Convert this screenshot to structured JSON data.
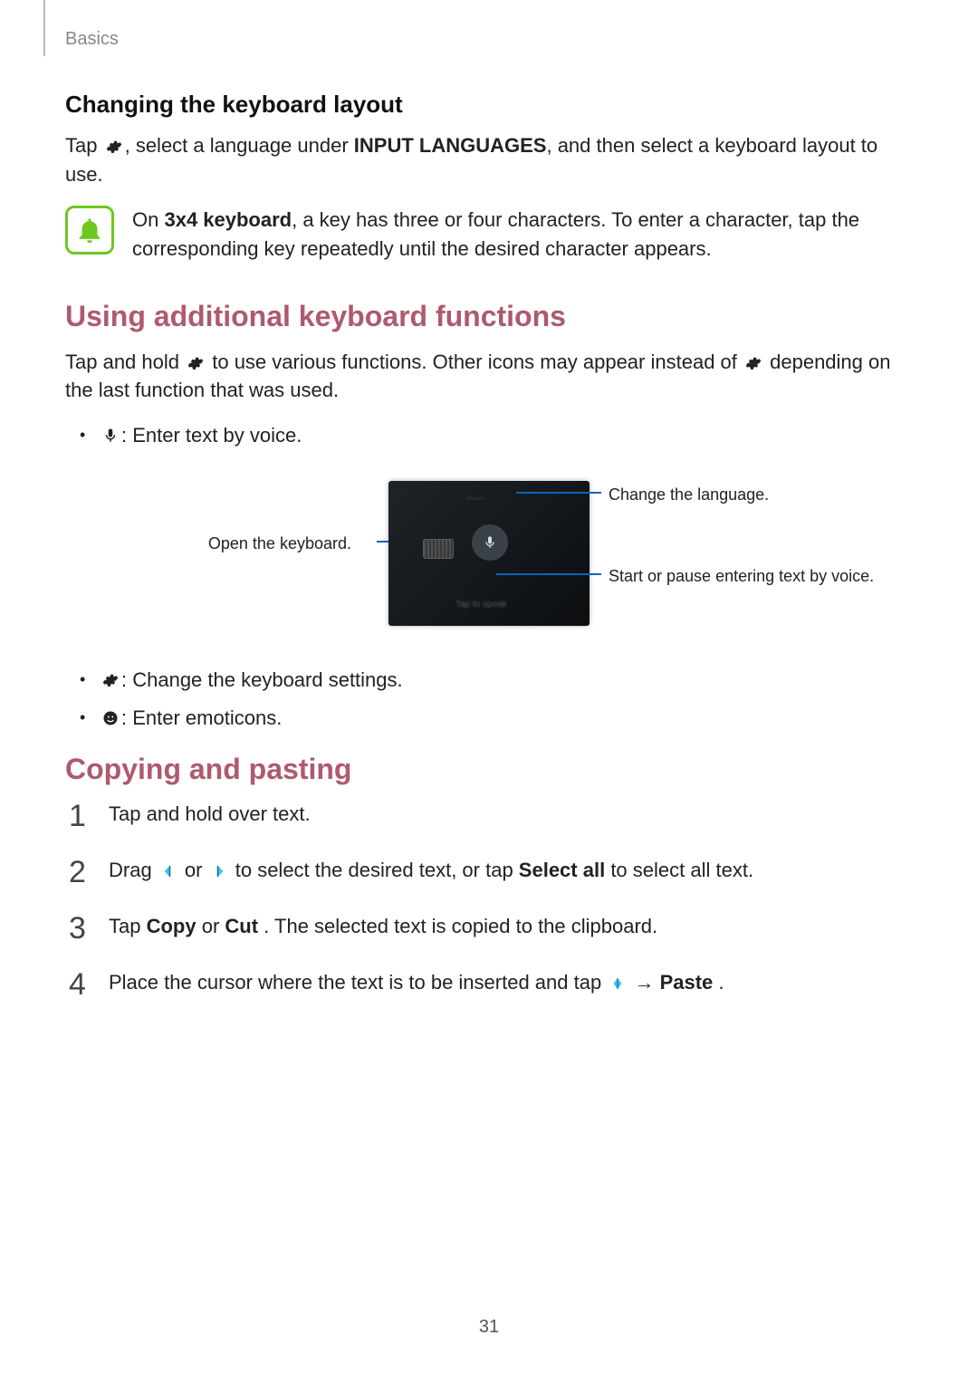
{
  "breadcrumb": "Basics",
  "section1": {
    "title": "Changing the keyboard layout",
    "p_pre": "Tap ",
    "p_mid": ", select a language under ",
    "p_bold_inline": "INPUT LANGUAGES",
    "p_post": ", and then select a keyboard layout to use."
  },
  "tip": {
    "pre": "On ",
    "bold": "3x4 keyboard",
    "post": ", a key has three or four characters. To enter a character, tap the corresponding key repeatedly until the desired character appears."
  },
  "section2": {
    "title": "Using additional keyboard functions",
    "p_pre": "Tap and hold ",
    "p_mid": " to use various functions. Other icons may appear instead of ",
    "p_post": " depending on the last function that was used.",
    "bullet_voice": " : Enter text by voice.",
    "callout_left": "Open the keyboard.",
    "callout_r1": "Change the language.",
    "callout_r2": "Start or pause entering text by voice.",
    "bullet_settings": " : Change the keyboard settings.",
    "bullet_emoticon": " : Enter emoticons."
  },
  "section3": {
    "title": "Copying and pasting",
    "steps": {
      "s1": "Tap and hold over text.",
      "s2_pre": "Drag ",
      "s2_mid": " or ",
      "s2_mid2": " to select the desired text, or tap ",
      "s2_bold": "Select all",
      "s2_post": " to select all text.",
      "s3_pre": "Tap ",
      "s3_b1": "Copy",
      "s3_mid": " or ",
      "s3_b2": "Cut",
      "s3_post": ". The selected text is copied to the clipboard.",
      "s4_pre": "Place the cursor where the text is to be inserted and tap ",
      "s4_arrow": " → ",
      "s4_bold": "Paste",
      "s4_post": "."
    }
  },
  "page_number": "31"
}
